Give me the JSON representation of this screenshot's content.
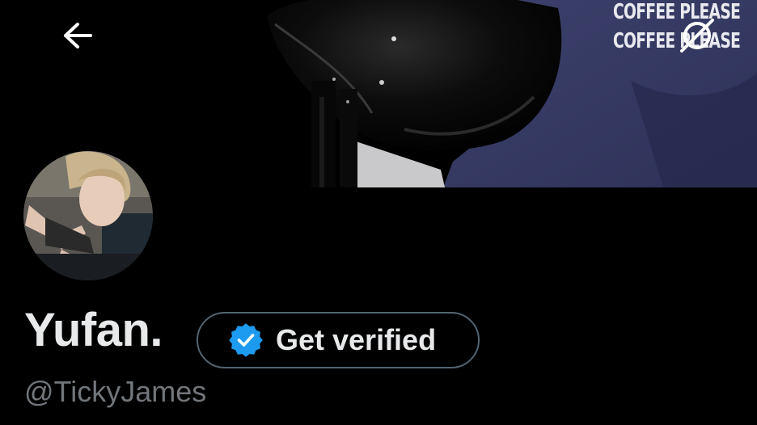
{
  "profile": {
    "display_name": "Yufan.",
    "handle": "@TickyJames",
    "verify_button_label": "Get verified"
  },
  "banner": {
    "shirt_text_line1": "COFFEE PLEASE",
    "shirt_text_line2": "COFFEE PLEASE"
  },
  "icons": {
    "back": "arrow-left-icon",
    "spaces": "spaces-icon",
    "verified": "verified-badge-icon"
  },
  "colors": {
    "background": "#000000",
    "text_primary": "#e7e9ea",
    "text_secondary": "#71767b",
    "verified_blue": "#1d9bf0",
    "button_border": "#536471",
    "shirt_navy": "#3a3f68"
  }
}
